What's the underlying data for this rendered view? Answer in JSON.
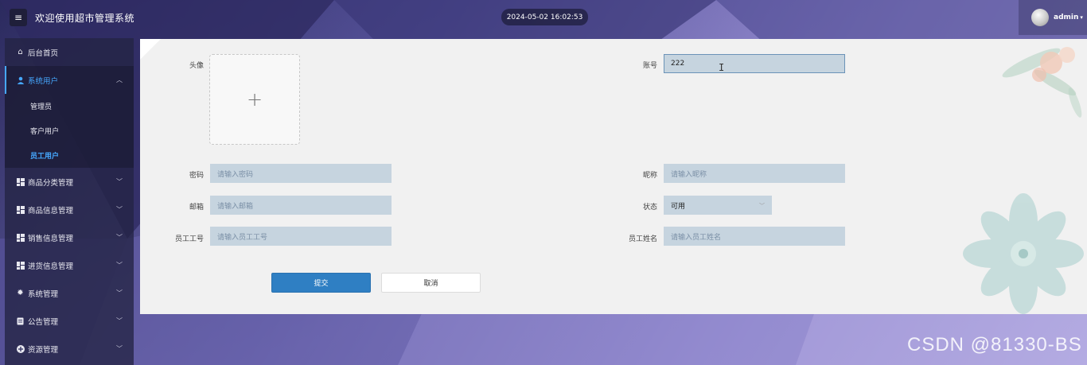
{
  "header": {
    "menu_icon": "hamburger-icon",
    "title": "欢迎使用超市管理系统",
    "datetime": "2024-05-02 16:02:53",
    "username": "admin"
  },
  "sidebar": {
    "items": [
      {
        "label": "后台首页",
        "icon": "home-icon"
      },
      {
        "label": "系统用户",
        "icon": "user-icon",
        "open": true,
        "children": [
          {
            "label": "管理员"
          },
          {
            "label": "客户用户"
          },
          {
            "label": "员工用户",
            "active": true
          }
        ]
      },
      {
        "label": "商品分类管理",
        "icon": "grid-icon"
      },
      {
        "label": "商品信息管理",
        "icon": "grid-icon"
      },
      {
        "label": "销售信息管理",
        "icon": "grid-icon"
      },
      {
        "label": "进货信息管理",
        "icon": "grid-icon"
      },
      {
        "label": "系统管理",
        "icon": "gear-icon"
      },
      {
        "label": "公告管理",
        "icon": "document-icon"
      },
      {
        "label": "资源管理",
        "icon": "plus-circle-icon"
      }
    ]
  },
  "form": {
    "avatar_label": "头像",
    "upload_symbol": "+",
    "account_label": "账号",
    "account_value": "222",
    "password_label": "密码",
    "password_placeholder": "请输入密码",
    "nickname_label": "昵称",
    "nickname_placeholder": "请输入昵称",
    "email_label": "邮箱",
    "email_placeholder": "请输入邮箱",
    "status_label": "状态",
    "status_value": "可用",
    "empno_label": "员工工号",
    "empno_placeholder": "请输入员工工号",
    "empname_label": "员工姓名",
    "empname_placeholder": "请输入员工姓名",
    "submit_label": "提交",
    "cancel_label": "取消"
  },
  "watermark": "CSDN @81330-BS"
}
